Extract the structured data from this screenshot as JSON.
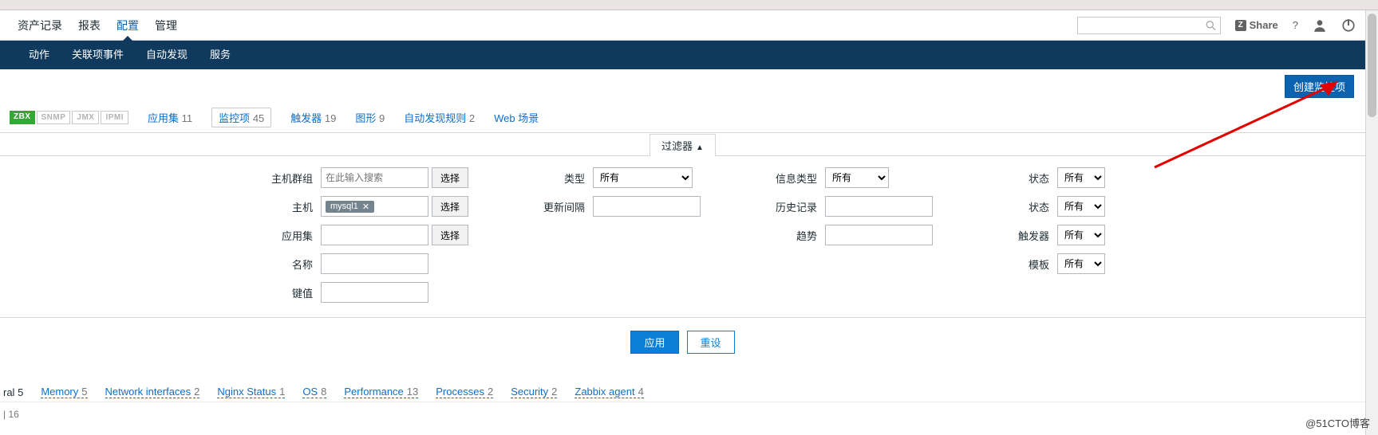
{
  "top_nav": {
    "items": [
      "资产记录",
      "报表",
      "配置",
      "管理"
    ],
    "active_index": 2,
    "share_label": "Share",
    "search_placeholder": ""
  },
  "sub_nav": {
    "items": [
      "动作",
      "关联项事件",
      "自动发现",
      "服务"
    ]
  },
  "create_button": "创建监控项",
  "proto": {
    "main": "ZBX",
    "disabled": [
      "SNMP",
      "JMX",
      "IPMI"
    ]
  },
  "page_tabs": [
    {
      "label": "应用集",
      "count": "11"
    },
    {
      "label": "监控项",
      "count": "45",
      "active": true
    },
    {
      "label": "触发器",
      "count": "19"
    },
    {
      "label": "图形",
      "count": "9"
    },
    {
      "label": "自动发现规则",
      "count": "2"
    },
    {
      "label": "Web 场景",
      "count": ""
    }
  ],
  "filter_toggle": "过滤器",
  "filter": {
    "col1": {
      "host_group": {
        "label": "主机群组",
        "placeholder": "在此输入搜索",
        "select_btn": "选择"
      },
      "host": {
        "label": "主机",
        "pill": "mysql1",
        "select_btn": "选择"
      },
      "app": {
        "label": "应用集",
        "select_btn": "选择"
      },
      "name": {
        "label": "名称"
      },
      "key": {
        "label": "键值"
      }
    },
    "col2": {
      "type": {
        "label": "类型",
        "value": "所有"
      },
      "interval": {
        "label": "更新间隔"
      }
    },
    "col3": {
      "info": {
        "label": "信息类型",
        "value": "所有"
      },
      "history": {
        "label": "历史记录"
      },
      "trend": {
        "label": "趋势"
      }
    },
    "col4": {
      "state": {
        "label": "状态",
        "value": "所有"
      },
      "status": {
        "label": "状态",
        "value": "所有"
      },
      "trigger": {
        "label": "触发器",
        "value": "所有"
      },
      "template": {
        "label": "模板",
        "value": "所有"
      }
    },
    "apply": "应用",
    "reset": "重设"
  },
  "app_list_prefix": "ral",
  "app_list_prefix_count": "5",
  "app_list": [
    {
      "label": "Memory",
      "count": "5"
    },
    {
      "label": "Network interfaces",
      "count": "2"
    },
    {
      "label": "Nginx Status",
      "count": "1"
    },
    {
      "label": "OS",
      "count": "8"
    },
    {
      "label": "Performance",
      "count": "13"
    },
    {
      "label": "Processes",
      "count": "2"
    },
    {
      "label": "Security",
      "count": "2"
    },
    {
      "label": "Zabbix agent",
      "count": "4"
    }
  ],
  "row_count": "16",
  "watermark": "@51CTO博客"
}
